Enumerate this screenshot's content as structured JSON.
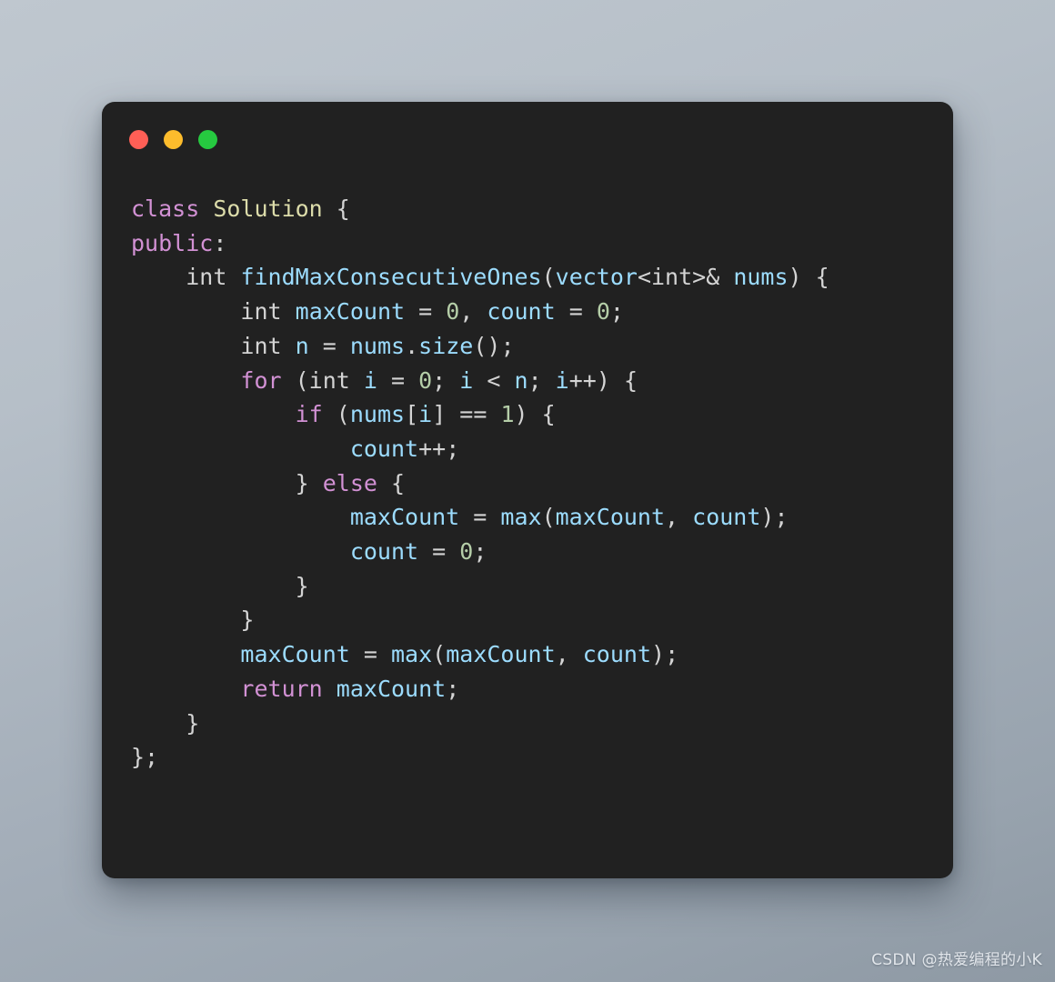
{
  "window": {
    "background_top_color": "#bfc7cf",
    "background_bottom_color": "#8e99a4",
    "card_background": "#212121",
    "traffic_lights": [
      {
        "name": "close",
        "color": "#ff5f56"
      },
      {
        "name": "minimize",
        "color": "#fdbc2c"
      },
      {
        "name": "maximize",
        "color": "#26c940"
      }
    ]
  },
  "theme": {
    "keyword_color": "#d291d4",
    "type_color": "#dcdcaa",
    "identifier_color": "#9cdcfe",
    "number_color": "#b5cea8",
    "plain_color": "#d4d4d4"
  },
  "code": {
    "language": "cpp",
    "lines": [
      [
        {
          "t": "class",
          "c": "key"
        },
        {
          "t": " ",
          "c": "plain"
        },
        {
          "t": "Solution",
          "c": "type"
        },
        {
          "t": " {",
          "c": "plain"
        }
      ],
      [
        {
          "t": "public",
          "c": "key"
        },
        {
          "t": ":",
          "c": "plain"
        }
      ],
      [
        {
          "t": "    int ",
          "c": "plain"
        },
        {
          "t": "findMaxConsecutiveOnes",
          "c": "ident"
        },
        {
          "t": "(",
          "c": "plain"
        },
        {
          "t": "vector",
          "c": "ident"
        },
        {
          "t": "<int>& ",
          "c": "plain"
        },
        {
          "t": "nums",
          "c": "ident"
        },
        {
          "t": ") {",
          "c": "plain"
        }
      ],
      [
        {
          "t": "        int ",
          "c": "plain"
        },
        {
          "t": "maxCount",
          "c": "ident"
        },
        {
          "t": " = ",
          "c": "plain"
        },
        {
          "t": "0",
          "c": "num"
        },
        {
          "t": ", ",
          "c": "plain"
        },
        {
          "t": "count",
          "c": "ident"
        },
        {
          "t": " = ",
          "c": "plain"
        },
        {
          "t": "0",
          "c": "num"
        },
        {
          "t": ";",
          "c": "plain"
        }
      ],
      [
        {
          "t": "        int ",
          "c": "plain"
        },
        {
          "t": "n",
          "c": "ident"
        },
        {
          "t": " = ",
          "c": "plain"
        },
        {
          "t": "nums",
          "c": "ident"
        },
        {
          "t": ".",
          "c": "plain"
        },
        {
          "t": "size",
          "c": "ident"
        },
        {
          "t": "();",
          "c": "plain"
        }
      ],
      [
        {
          "t": "        ",
          "c": "plain"
        },
        {
          "t": "for",
          "c": "key"
        },
        {
          "t": " (int ",
          "c": "plain"
        },
        {
          "t": "i",
          "c": "ident"
        },
        {
          "t": " = ",
          "c": "plain"
        },
        {
          "t": "0",
          "c": "num"
        },
        {
          "t": "; ",
          "c": "plain"
        },
        {
          "t": "i",
          "c": "ident"
        },
        {
          "t": " < ",
          "c": "plain"
        },
        {
          "t": "n",
          "c": "ident"
        },
        {
          "t": "; ",
          "c": "plain"
        },
        {
          "t": "i",
          "c": "ident"
        },
        {
          "t": "++) {",
          "c": "plain"
        }
      ],
      [
        {
          "t": "            ",
          "c": "plain"
        },
        {
          "t": "if",
          "c": "key"
        },
        {
          "t": " (",
          "c": "plain"
        },
        {
          "t": "nums",
          "c": "ident"
        },
        {
          "t": "[",
          "c": "plain"
        },
        {
          "t": "i",
          "c": "ident"
        },
        {
          "t": "] == ",
          "c": "plain"
        },
        {
          "t": "1",
          "c": "num"
        },
        {
          "t": ") {",
          "c": "plain"
        }
      ],
      [
        {
          "t": "                ",
          "c": "plain"
        },
        {
          "t": "count",
          "c": "ident"
        },
        {
          "t": "++;",
          "c": "plain"
        }
      ],
      [
        {
          "t": "            } ",
          "c": "plain"
        },
        {
          "t": "else",
          "c": "key"
        },
        {
          "t": " {",
          "c": "plain"
        }
      ],
      [
        {
          "t": "                ",
          "c": "plain"
        },
        {
          "t": "maxCount",
          "c": "ident"
        },
        {
          "t": " = ",
          "c": "plain"
        },
        {
          "t": "max",
          "c": "ident"
        },
        {
          "t": "(",
          "c": "plain"
        },
        {
          "t": "maxCount",
          "c": "ident"
        },
        {
          "t": ", ",
          "c": "plain"
        },
        {
          "t": "count",
          "c": "ident"
        },
        {
          "t": ");",
          "c": "plain"
        }
      ],
      [
        {
          "t": "                ",
          "c": "plain"
        },
        {
          "t": "count",
          "c": "ident"
        },
        {
          "t": " = ",
          "c": "plain"
        },
        {
          "t": "0",
          "c": "num"
        },
        {
          "t": ";",
          "c": "plain"
        }
      ],
      [
        {
          "t": "            }",
          "c": "plain"
        }
      ],
      [
        {
          "t": "        }",
          "c": "plain"
        }
      ],
      [
        {
          "t": "        ",
          "c": "plain"
        },
        {
          "t": "maxCount",
          "c": "ident"
        },
        {
          "t": " = ",
          "c": "plain"
        },
        {
          "t": "max",
          "c": "ident"
        },
        {
          "t": "(",
          "c": "plain"
        },
        {
          "t": "maxCount",
          "c": "ident"
        },
        {
          "t": ", ",
          "c": "plain"
        },
        {
          "t": "count",
          "c": "ident"
        },
        {
          "t": ");",
          "c": "plain"
        }
      ],
      [
        {
          "t": "        ",
          "c": "plain"
        },
        {
          "t": "return",
          "c": "key"
        },
        {
          "t": " ",
          "c": "plain"
        },
        {
          "t": "maxCount",
          "c": "ident"
        },
        {
          "t": ";",
          "c": "plain"
        }
      ],
      [
        {
          "t": "    }",
          "c": "plain"
        }
      ],
      [
        {
          "t": "};",
          "c": "plain"
        }
      ]
    ]
  },
  "watermark": {
    "text": "CSDN @热爱编程的小K"
  }
}
